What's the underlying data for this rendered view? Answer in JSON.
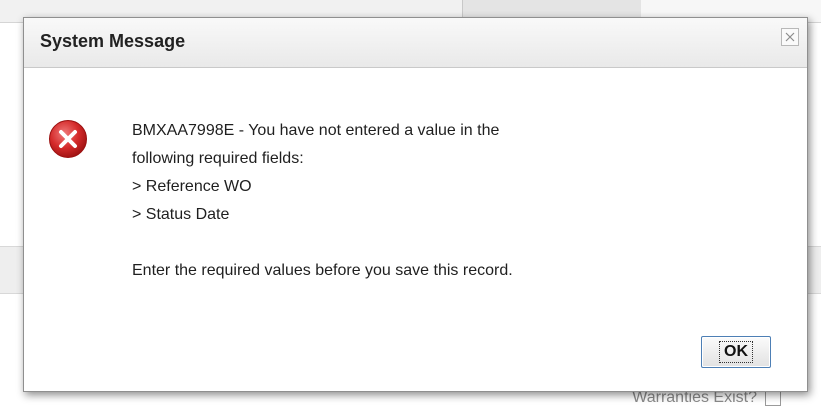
{
  "background": {
    "bottom_label": "Warranties Exist?"
  },
  "dialog": {
    "title": "System Message",
    "close_icon": "close-icon",
    "status_icon": "error-icon",
    "message_lines": [
      "BMXAA7998E - You have not entered a value in the",
      "following required fields:",
      "> Reference WO",
      "> Status Date"
    ],
    "instruction": "Enter the required values before you save this record.",
    "ok_label": "OK"
  },
  "colors": {
    "error_red": "#d42a2a",
    "button_border": "#4d7fb5"
  }
}
